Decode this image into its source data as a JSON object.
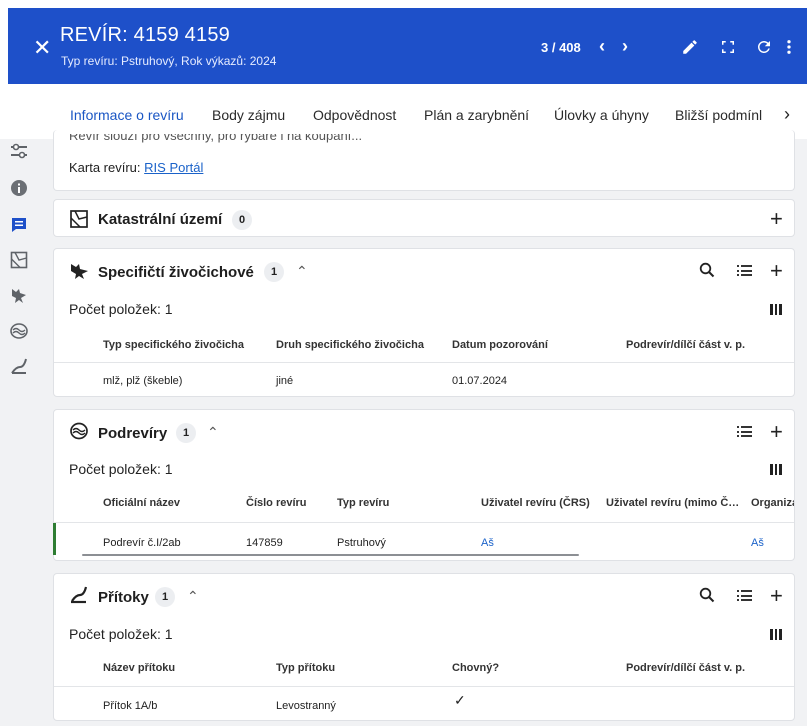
{
  "header": {
    "title": "REVÍR: 4159 4159",
    "subtitle": "Typ revíru: Pstruhový, Rok výkazů: 2024",
    "pager": "3 / 408"
  },
  "tabs": [
    "Informace o revíru",
    "Body zájmu",
    "Odpovědnost",
    "Plán a zarybnění",
    "Úlovky a úhyny",
    "Bližší podmínl"
  ],
  "info": {
    "partial_text": "Revír slouží pro všechny, pro rybáře i na koupání...",
    "map_label": "Karta revíru:",
    "map_link": "RIS Portál"
  },
  "katastr": {
    "title": "Katastrální území",
    "count": "0"
  },
  "zivocichove": {
    "title": "Specifičtí živočichové",
    "count": "1",
    "items_label": "Počet položek: 1",
    "columns": [
      "Typ specifického živočicha",
      "Druh specifického živočicha",
      "Datum pozorování",
      "Podrevír/dílčí část v. p."
    ],
    "rows": [
      [
        "mlž, plž (škeble)",
        "jiné",
        "01.07.2024",
        ""
      ]
    ]
  },
  "podreviry": {
    "title": "Podrevíry",
    "count": "1",
    "items_label": "Počet položek: 1",
    "columns": [
      "Oficiální název",
      "Číslo revíru",
      "Typ revíru",
      "Uživatel revíru (ČRS)",
      "Uživatel revíru (mimo Č…",
      "Organiza"
    ],
    "rows": [
      [
        "Podrevír č.I/2ab",
        "147859",
        "Pstruhový",
        "Aš",
        "",
        "Aš"
      ]
    ]
  },
  "pritoky": {
    "title": "Přítoky",
    "count": "1",
    "items_label": "Počet položek: 1",
    "columns": [
      "Název přítoku",
      "Typ přítoku",
      "Chovný?",
      "Podrevír/dílčí část v. p."
    ],
    "rows": [
      [
        "Přítok 1A/b",
        "Levostranný",
        "✓",
        ""
      ]
    ]
  },
  "colors": {
    "primary": "#1e50c9",
    "link": "#1a62c9",
    "active_row": "#2e7d32"
  }
}
